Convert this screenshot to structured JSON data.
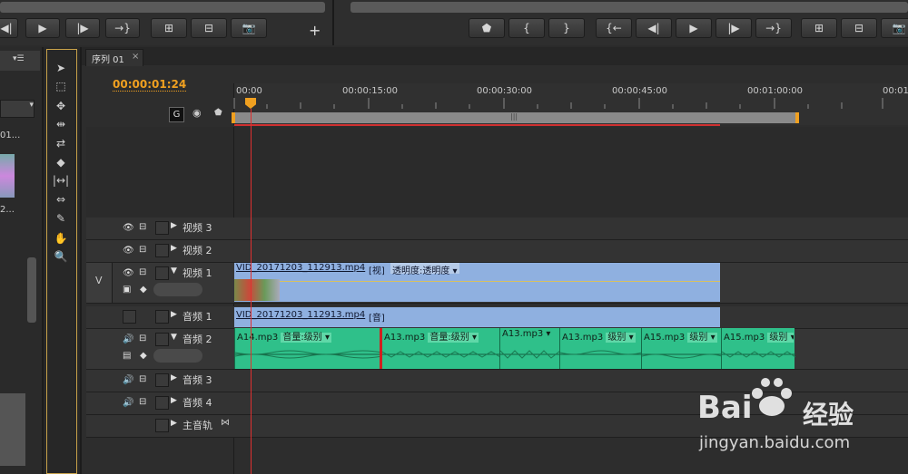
{
  "monitor": {
    "add_symbol": "+"
  },
  "sequence_tab": {
    "label": "序列 01",
    "close": "×"
  },
  "timecode": "00:00:01:24",
  "ruler": {
    "labels": [
      "00:00",
      "00:00:15:00",
      "00:00:30:00",
      "00:00:45:00",
      "00:01:00:00",
      "00:01"
    ]
  },
  "tracks": {
    "video3": "视频 3",
    "video2": "视频 2",
    "video1": "视频 1",
    "video1_target": "V",
    "audio1": "音频 1",
    "audio2": "音频 2",
    "audio3": "音频 3",
    "audio4": "音频 4",
    "master": "主音轨"
  },
  "clips": {
    "video1": {
      "name": "VID_20171203_112913.mp4",
      "tag": "[视]",
      "effect": "透明度:透明度"
    },
    "audio1": {
      "name": "VID_20171203_112913.mp4",
      "tag": "[音]"
    },
    "audio2": [
      {
        "name": "A14.mp3",
        "effect": "音量:级别"
      },
      {
        "name": "A13.mp3",
        "effect": "音量:级别"
      },
      {
        "name": "A13.mp3",
        "effect": ""
      },
      {
        "name": "A13.mp3",
        "effect": "级别"
      },
      {
        "name": "A15.mp3",
        "effect": "级别"
      },
      {
        "name": "A15.mp3",
        "effect": "级别"
      }
    ]
  },
  "left_panel": {
    "item1": "01...",
    "item2": "2..."
  },
  "watermark": {
    "logo": "Bai",
    "logo2": "经验",
    "url": "jingyan.baidu.com"
  },
  "colors": {
    "timecode": "#f0a020",
    "video_clip": "#8fb0e0",
    "audio_clip": "#2fc08a",
    "playhead": "#e03030"
  }
}
